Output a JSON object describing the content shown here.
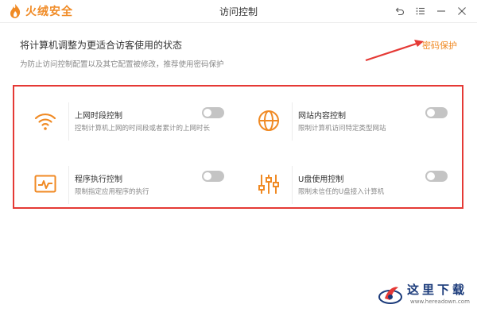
{
  "app": {
    "logo_text": "火绒安全",
    "window_title": "访问控制"
  },
  "header": {
    "title": "将计算机调整为更适合访客使用的状态",
    "subtitle": "为防止访问控制配置以及其它配置被修改，推荐使用密码保护",
    "password_link": "密码保护"
  },
  "cards": [
    {
      "title": "上网时段控制",
      "desc": "控制计算机上网的时间段或者累计的上网时长",
      "icon": "wifi-icon",
      "enabled": false
    },
    {
      "title": "网站内容控制",
      "desc": "限制计算机访问特定类型网站",
      "icon": "globe-icon",
      "enabled": false
    },
    {
      "title": "程序执行控制",
      "desc": "限制指定应用程序的执行",
      "icon": "program-monitor-icon",
      "enabled": false
    },
    {
      "title": "U盘使用控制",
      "desc": "限制未信任的U盘接入计算机",
      "icon": "usb-sliders-icon",
      "enabled": false
    }
  ],
  "watermark": {
    "title": "这里下载",
    "url": "www.hereadown.com"
  },
  "colors": {
    "accent": "#f08a24",
    "highlight_border": "#e53935",
    "toggle_off": "#c4c4c4"
  }
}
